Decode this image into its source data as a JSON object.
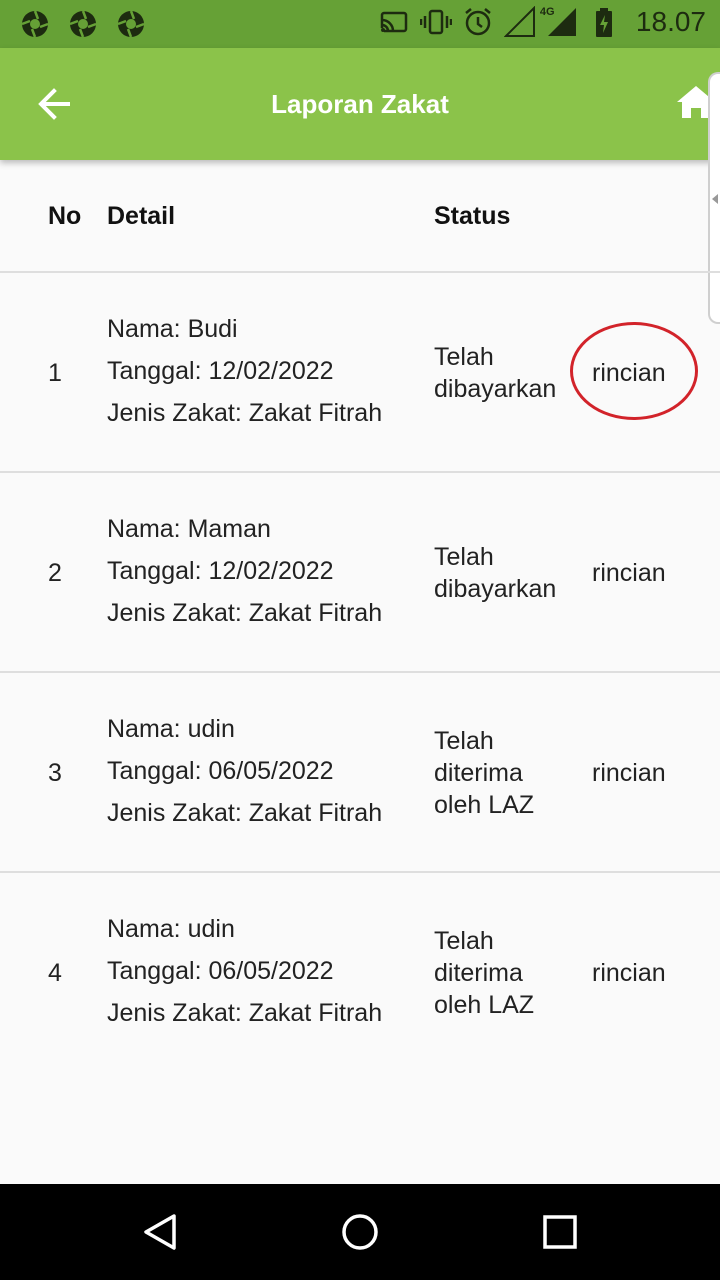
{
  "status_bar": {
    "time": "18.07",
    "network_label": "4G",
    "left_icons": [
      "aperture-icon",
      "aperture-icon",
      "aperture-icon"
    ],
    "right_icons": [
      "cast-icon",
      "vibrate-icon",
      "alarm-icon",
      "signal-icon",
      "battery-charging-icon"
    ]
  },
  "app_bar": {
    "title": "Laporan Zakat",
    "back_icon": "arrow-left-icon",
    "home_icon": "home-icon",
    "color": "#8bc34a"
  },
  "table": {
    "headers": {
      "no": "No",
      "detail": "Detail",
      "status": "Status"
    },
    "rows": [
      {
        "no": "1",
        "nama": "Nama: Budi",
        "tanggal": "Tanggal: 12/02/2022",
        "jenis": "Jenis Zakat: Zakat Fitrah",
        "status": [
          "Telah",
          "dibayarkan"
        ],
        "link": "rincian",
        "highlighted": true
      },
      {
        "no": "2",
        "nama": "Nama: Maman",
        "tanggal": "Tanggal: 12/02/2022",
        "jenis": "Jenis Zakat: Zakat Fitrah",
        "status": [
          "Telah",
          "dibayarkan"
        ],
        "link": "rincian"
      },
      {
        "no": "3",
        "nama": "Nama: udin",
        "tanggal": "Tanggal: 06/05/2022",
        "jenis": "Jenis Zakat: Zakat Fitrah",
        "status": [
          "Telah",
          "diterima",
          "oleh LAZ"
        ],
        "link": "rincian"
      },
      {
        "no": "4",
        "nama": "Nama: udin",
        "tanggal": "Tanggal: 06/05/2022",
        "jenis": "Jenis Zakat: Zakat Fitrah",
        "status": [
          "Telah",
          "diterima",
          "oleh LAZ"
        ],
        "link": "rincian"
      }
    ]
  },
  "nav_bar": {
    "buttons": [
      "back-triangle-icon",
      "home-circle-icon",
      "recents-square-icon"
    ]
  },
  "colors": {
    "status_bar": "#66a136",
    "app_bar": "#8bc34a",
    "highlight_circle": "#d2232a"
  }
}
